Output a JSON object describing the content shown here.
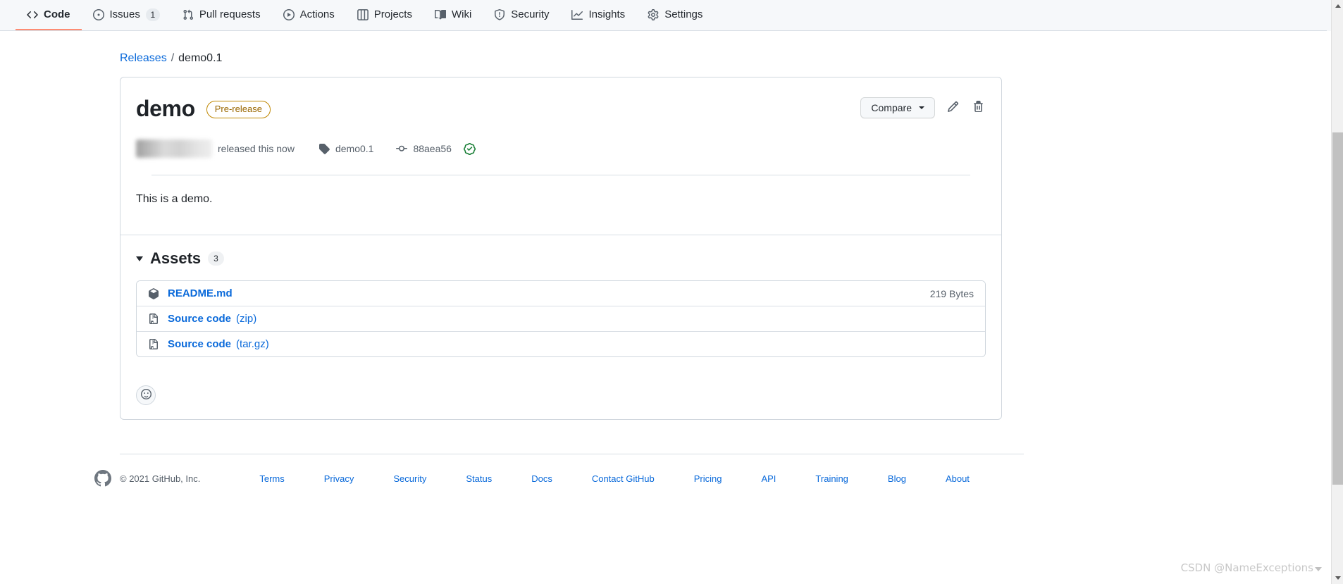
{
  "repo_nav": {
    "items": [
      {
        "label": "Code",
        "icon": "code-icon",
        "selected": true,
        "counter": null
      },
      {
        "label": "Issues",
        "icon": "issue-opened-icon",
        "selected": false,
        "counter": "1"
      },
      {
        "label": "Pull requests",
        "icon": "git-pull-request-icon",
        "selected": false,
        "counter": null
      },
      {
        "label": "Actions",
        "icon": "play-icon",
        "selected": false,
        "counter": null
      },
      {
        "label": "Projects",
        "icon": "project-icon",
        "selected": false,
        "counter": null
      },
      {
        "label": "Wiki",
        "icon": "book-icon",
        "selected": false,
        "counter": null
      },
      {
        "label": "Security",
        "icon": "shield-icon",
        "selected": false,
        "counter": null
      },
      {
        "label": "Insights",
        "icon": "graph-icon",
        "selected": false,
        "counter": null
      },
      {
        "label": "Settings",
        "icon": "gear-icon",
        "selected": false,
        "counter": null
      }
    ]
  },
  "breadcrumb": {
    "releases_label": "Releases",
    "separator": "/",
    "current": "demo0.1"
  },
  "release": {
    "title": "demo",
    "badge": "Pre-release",
    "badge_color": "#9a6700",
    "author_redacted": true,
    "released_text": "released this now",
    "tag": {
      "icon": "tag-icon",
      "label": "demo0.1"
    },
    "commit": {
      "icon": "git-commit-icon",
      "sha": "88aea56",
      "verified_icon": "verified-check-icon",
      "verified_color": "#1a7f37"
    },
    "body": "This is a demo.",
    "actions": {
      "compare_label": "Compare",
      "edit_icon": "pencil-icon",
      "delete_icon": "trash-icon"
    }
  },
  "assets": {
    "title": "Assets",
    "count": "3",
    "expanded": true,
    "rows": [
      {
        "icon": "package-icon",
        "name": "README.md",
        "format": "",
        "size": "219 Bytes"
      },
      {
        "icon": "file-zip-icon",
        "name": "Source code",
        "format": "(zip)",
        "size": ""
      },
      {
        "icon": "file-zip-icon",
        "name": "Source code",
        "format": "(tar.gz)",
        "size": ""
      }
    ]
  },
  "reaction": {
    "icon": "smiley-icon"
  },
  "footer": {
    "logo_icon": "github-mark-icon",
    "copyright": "© 2021 GitHub, Inc.",
    "links": [
      "Terms",
      "Privacy",
      "Security",
      "Status",
      "Docs",
      "Contact GitHub",
      "Pricing",
      "API",
      "Training",
      "Blog",
      "About"
    ]
  },
  "watermark": {
    "text": "CSDN @NameExceptions"
  }
}
